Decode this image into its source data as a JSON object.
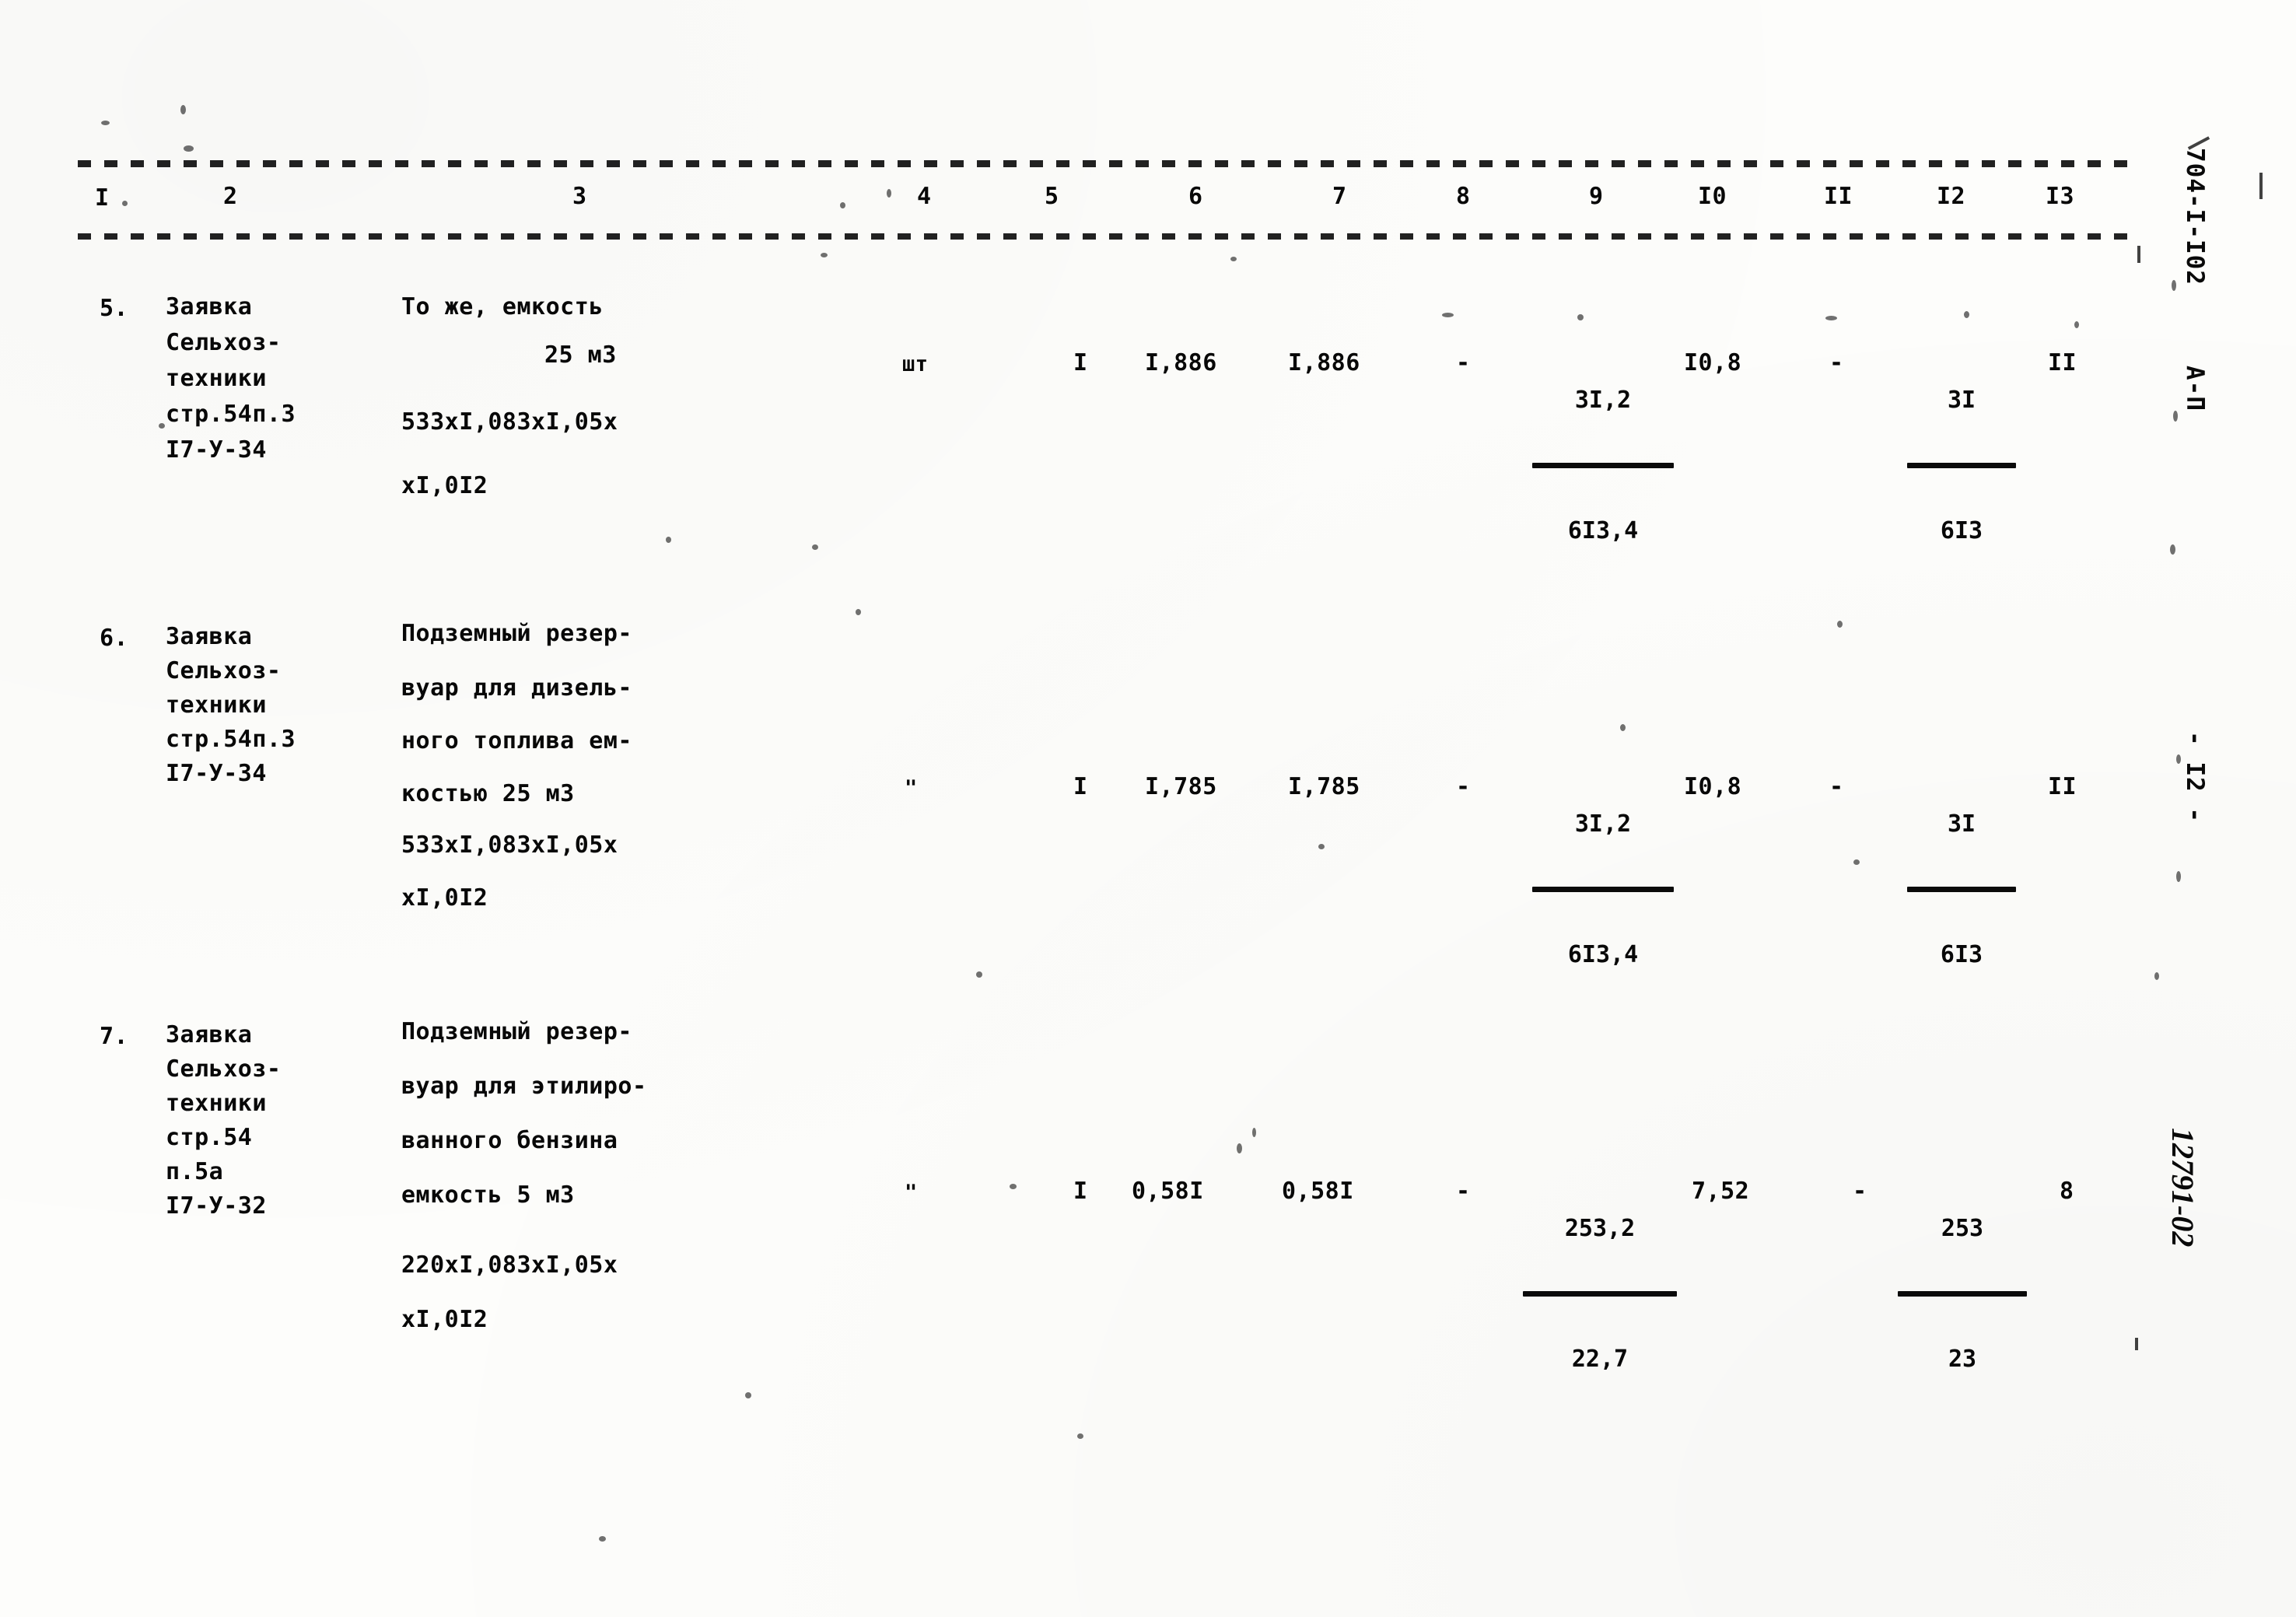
{
  "document": {
    "kind": "scanned-typewritten-specification-table",
    "page_number_margin": "- I2 -",
    "series_code_margin": "704-I-I02",
    "sheet_class_margin": "А-П",
    "handwritten_margin": "12791-02"
  },
  "table": {
    "column_numbers": [
      "I",
      "2",
      "3",
      "4",
      "5",
      "6",
      "7",
      "8",
      "9",
      "I0",
      "II",
      "I2",
      "I3"
    ],
    "rows": [
      {
        "index": "5.",
        "source_lines": [
          "Заявка",
          "Сельхоз-",
          "техники",
          "стр.54п.3",
          "I7-У-34"
        ],
        "description_lines": [
          "То же, емкость",
          "25 м3",
          "533хI,083хI,05х",
          "хI,0I2"
        ],
        "unit": "шт",
        "col5": "I",
        "col6": "I,886",
        "col7": "I,886",
        "col8": "-",
        "col9_num": "3I,2",
        "col9_den": "6I3,4",
        "col10": "I0,8",
        "col11": "-",
        "col12_num": "3I",
        "col12_den": "6I3",
        "col13": "II"
      },
      {
        "index": "6.",
        "source_lines": [
          "Заявка",
          "Сельхоз-",
          "техники",
          "стр.54п.3",
          "I7-У-34"
        ],
        "description_lines": [
          "Подземный резер-",
          "вуар для дизель-",
          "ного топлива ем-",
          "костью 25 м3",
          "533хI,083хI,05х",
          "хI,0I2"
        ],
        "unit": "\"",
        "col5": "I",
        "col6": "I,785",
        "col7": "I,785",
        "col8": "-",
        "col9_num": "3I,2",
        "col9_den": "6I3,4",
        "col10": "I0,8",
        "col11": "-",
        "col12_num": "3I",
        "col12_den": "6I3",
        "col13": "II"
      },
      {
        "index": "7.",
        "source_lines": [
          "Заявка",
          "Сельхоз-",
          "техники",
          "стр.54",
          "п.5а",
          "I7-У-32"
        ],
        "description_lines": [
          "Подземный резер-",
          "вуар для этилиро-",
          "ванного бензина",
          "емкость 5 м3",
          "220хI,083хI,05х",
          "хI,0I2"
        ],
        "unit": "\"",
        "col5": "I",
        "col6": "0,58I",
        "col7": "0,58I",
        "col8": "-",
        "col9_num": "253,2",
        "col9_den": "22,7",
        "col10": "7,52",
        "col11": "-",
        "col12_num": "253",
        "col12_den": "23",
        "col13": "8"
      }
    ]
  }
}
